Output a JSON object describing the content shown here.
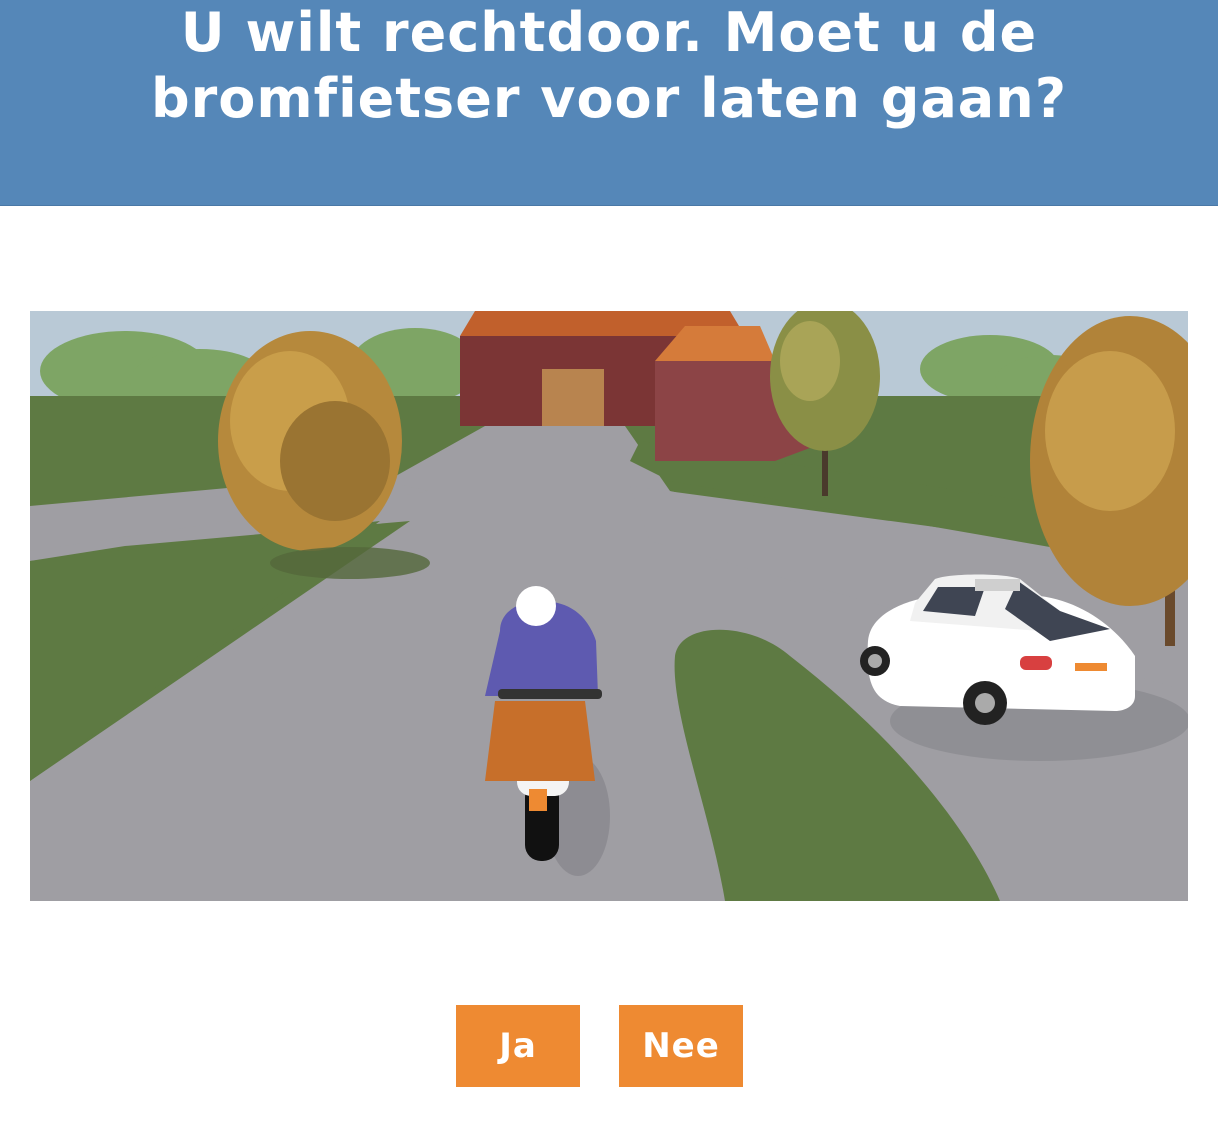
{
  "question": {
    "text": "U wilt rechtdoor. Moet u de bromfietser voor laten gaan?"
  },
  "scene": {
    "depicts": [
      "road",
      "moped-rider",
      "white-car",
      "barn",
      "trees"
    ]
  },
  "answers": {
    "yes_label": "Ja",
    "no_label": "Nee"
  },
  "colors": {
    "header_background": "#5587b8",
    "button_background": "#ee8a32",
    "button_text": "#ffffff"
  }
}
